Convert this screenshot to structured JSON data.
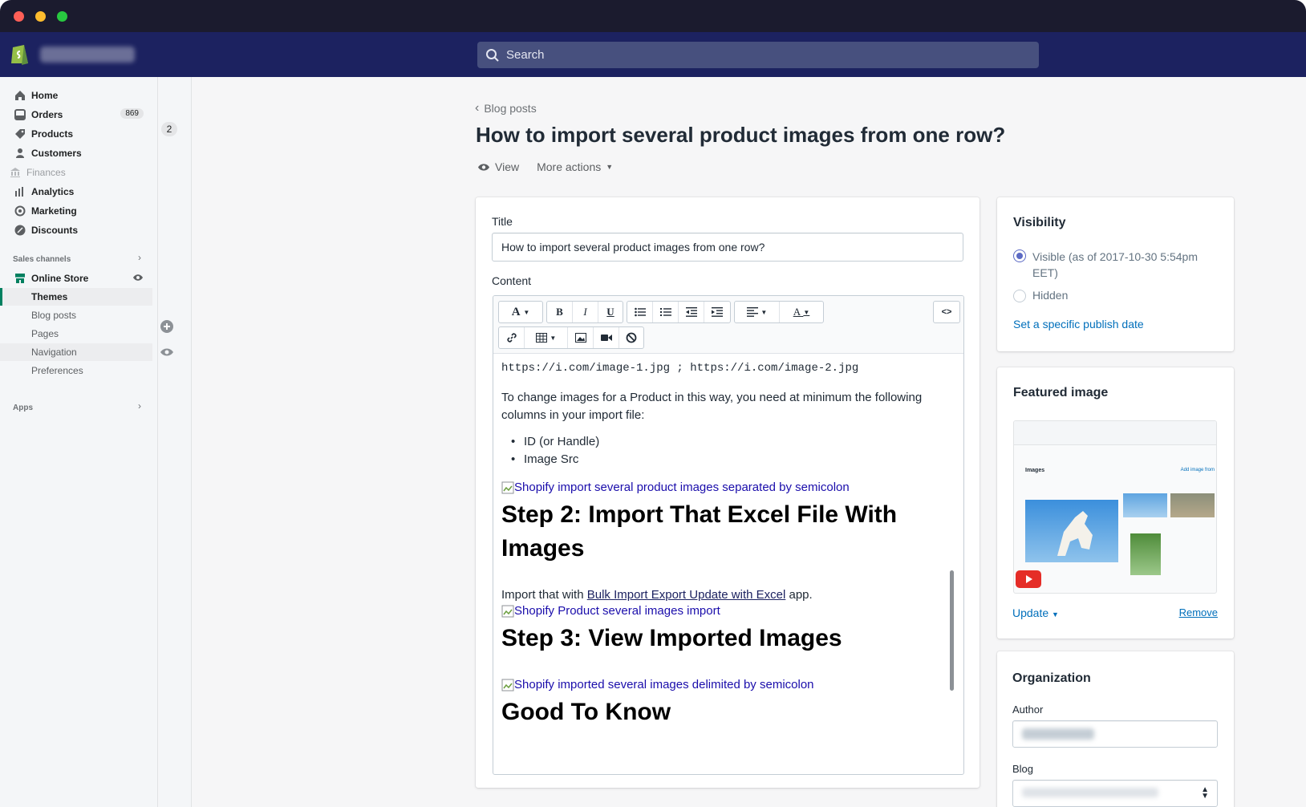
{
  "search": {
    "placeholder": "Search"
  },
  "sidebar": {
    "items": [
      {
        "label": "Home"
      },
      {
        "label": "Orders",
        "badge": "869"
      },
      {
        "label": "Products"
      },
      {
        "label": "Customers"
      },
      {
        "label": "Finances"
      },
      {
        "label": "Analytics"
      },
      {
        "label": "Marketing"
      },
      {
        "label": "Discounts"
      }
    ],
    "sales_channels_label": "Sales channels",
    "online_store": "Online Store",
    "sub_items": [
      {
        "label": "Themes"
      },
      {
        "label": "Blog posts"
      },
      {
        "label": "Pages"
      },
      {
        "label": "Navigation"
      },
      {
        "label": "Preferences"
      }
    ],
    "apps_label": "Apps",
    "gutter_badge": "2"
  },
  "page": {
    "breadcrumb": "Blog posts",
    "title": "How to import several product images from one row?",
    "view_label": "View",
    "more_actions_label": "More actions"
  },
  "editor_card": {
    "title_label": "Title",
    "title_value": "How to import several product images from one row?",
    "content_label": "Content",
    "toolbar": {
      "font": "A",
      "bold": "B",
      "italic": "I",
      "underline": "U",
      "color": "A",
      "source": "<>"
    },
    "content": {
      "code_line": "https://i.com/image-1.jpg ; https://i.com/image-2.jpg",
      "para1": "To change images for a Product in this way, you need at minimum the following columns in your import file:",
      "bullets": [
        "ID (or Handle)",
        "Image Src"
      ],
      "img1": "Shopify import several product images separated by semicolon",
      "h2_step2": "Step 2: Import That Excel File With Images",
      "para2_before": "Import that with ",
      "para2_link": "Bulk Import Export Update with Excel",
      "para2_after": " app.",
      "img2": "Shopify Product several images import",
      "h2_step3": "Step 3: View Imported Images",
      "img3": "Shopify imported several images delimited by semicolon",
      "h2_good": "Good To Know"
    }
  },
  "visibility": {
    "heading": "Visibility",
    "visible_label": "Visible (as of 2017-10-30 5:54pm EET)",
    "hidden_label": "Hidden",
    "publish_link": "Set a specific publish date"
  },
  "featured": {
    "heading": "Featured image",
    "thumb_label": "Images",
    "thumb_link": "Add image from",
    "update_label": "Update",
    "remove_label": "Remove"
  },
  "organization": {
    "heading": "Organization",
    "author_label": "Author",
    "blog_label": "Blog"
  },
  "colors": {
    "topbar": "#1c2260",
    "accent": "#5c6ac4",
    "link": "#006fbb",
    "active_indicator": "#008060"
  }
}
